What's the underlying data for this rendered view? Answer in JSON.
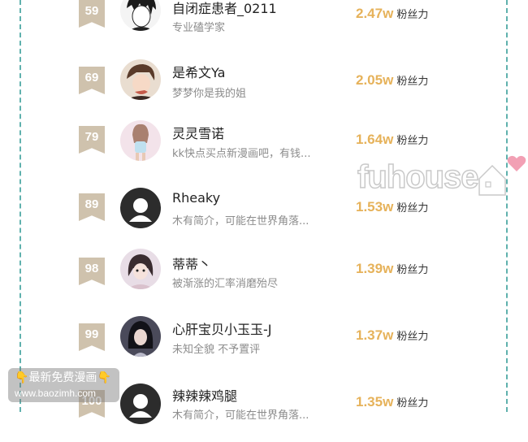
{
  "leaderboard": {
    "fans_unit": "粉丝力",
    "rows": [
      {
        "rank": "59",
        "name": "自闭症患者_0211",
        "desc": "专业磕学家",
        "fans": "2.47w"
      },
      {
        "rank": "69",
        "name": "是希文Ya",
        "desc": "梦梦你是我的姐",
        "fans": "2.05w"
      },
      {
        "rank": "79",
        "name": "灵灵雪诺",
        "desc": "kk快点买点新漫画吧，有钱...",
        "fans": "1.64w"
      },
      {
        "rank": "89",
        "name": "Rheaky",
        "desc": "木有简介，可能在世界角落...",
        "fans": "1.53w"
      },
      {
        "rank": "98",
        "name": "蒂蒂丶",
        "desc": "被渐涨的汇率消磨殆尽",
        "fans": "1.39w"
      },
      {
        "rank": "99",
        "name": "心肝宝贝小玉玉-J",
        "desc": "未知全貌 不予置评",
        "fans": "1.37w"
      },
      {
        "rank": "100",
        "name": "辣辣辣鸡腿",
        "desc": "木有简介，可能在世界角落...",
        "fans": "1.35w"
      }
    ]
  },
  "watermark": {
    "text": "fuhouse"
  },
  "promo": {
    "title": "最新免费漫画",
    "url": "www.baozimh.com"
  },
  "colors": {
    "accent": "#e6b25a",
    "badge": "#cfc2ad",
    "frame": "#5fb1ad"
  }
}
